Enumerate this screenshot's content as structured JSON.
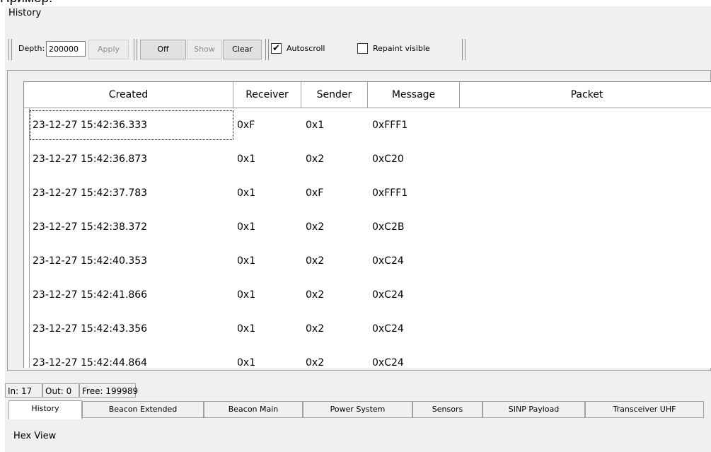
{
  "caption": "Пример:",
  "window_title": "History",
  "toolbar": {
    "depth_label": "Depth:",
    "depth_value": "200000",
    "apply": "Apply",
    "off": "Off",
    "show": "Show",
    "clear": "Clear",
    "autoscroll_check": "✔",
    "autoscroll": "Autoscroll",
    "repaint": "Repaint visible"
  },
  "table": {
    "columns": [
      "Created",
      "Receiver",
      "Sender",
      "Message",
      "Packet"
    ],
    "rows": [
      [
        "23-12-27 15:42:36.333",
        "0xF",
        "0x1",
        "0xFFF1",
        ""
      ],
      [
        "23-12-27 15:42:36.873",
        "0x1",
        "0x2",
        "0xC20",
        ""
      ],
      [
        "23-12-27 15:42:37.783",
        "0x1",
        "0xF",
        "0xFFF1",
        ""
      ],
      [
        "23-12-27 15:42:38.372",
        "0x1",
        "0x2",
        "0xC2B",
        ""
      ],
      [
        "23-12-27 15:42:40.353",
        "0x1",
        "0x2",
        "0xC24",
        ""
      ],
      [
        "23-12-27 15:42:41.866",
        "0x1",
        "0x2",
        "0xC24",
        ""
      ],
      [
        "23-12-27 15:42:43.356",
        "0x1",
        "0x2",
        "0xC24",
        ""
      ],
      [
        "23-12-27 15:42:44.864",
        "0x1",
        "0x2",
        "0xC24",
        ""
      ]
    ]
  },
  "status": {
    "in": "In: 17",
    "out": "Out: 0",
    "free": "Free: 199989"
  },
  "tabs": [
    "History",
    "Beacon Extended",
    "Beacon Main",
    "Power System",
    "Sensors",
    "SINP Payload",
    "Transceiver UHF"
  ],
  "hex_view": "Hex View"
}
